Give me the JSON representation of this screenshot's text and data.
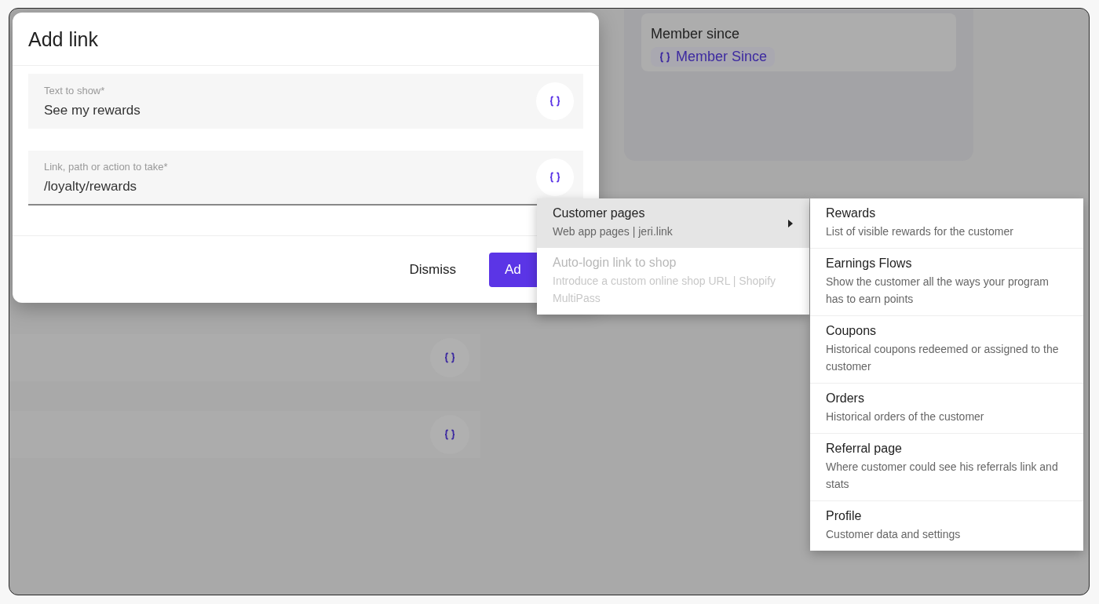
{
  "background": {
    "card": {
      "label": "Member since",
      "variable": "Member Since"
    },
    "rows": [
      {
        "kind": "variable"
      },
      {
        "kind": "variable"
      }
    ]
  },
  "dialog": {
    "title": "Add link",
    "fields": [
      {
        "label": "Text to show*",
        "value": "See my rewards",
        "focused": false
      },
      {
        "label": "Link, path or action to take*",
        "value": "/loyalty/rewards",
        "focused": true
      }
    ],
    "buttons": [
      {
        "label": "Dismiss",
        "kind": "text"
      },
      {
        "label": "Ad",
        "kind": "primary"
      }
    ]
  },
  "menu": {
    "items": [
      {
        "title": "Customer pages",
        "subtitle": "Web app pages | jeri.link",
        "selected": true,
        "disabled": false,
        "has_submenu": true
      },
      {
        "title": "Auto-login link to shop",
        "subtitle": "Introduce a custom online shop URL | Shopify MultiPass",
        "selected": false,
        "disabled": true,
        "has_submenu": false
      }
    ]
  },
  "submenu": {
    "items": [
      {
        "title": "Rewards",
        "subtitle": "List of visible rewards for the customer"
      },
      {
        "title": "Earnings Flows",
        "subtitle": "Show the customer all the ways your program has to earn points"
      },
      {
        "title": "Coupons",
        "subtitle": "Historical coupons redeemed or assigned to the customer"
      },
      {
        "title": "Orders",
        "subtitle": "Historical orders of the customer"
      },
      {
        "title": "Referral page",
        "subtitle": "Where customer could see his referrals link and stats"
      },
      {
        "title": "Profile",
        "subtitle": "Customer data and settings"
      }
    ]
  }
}
